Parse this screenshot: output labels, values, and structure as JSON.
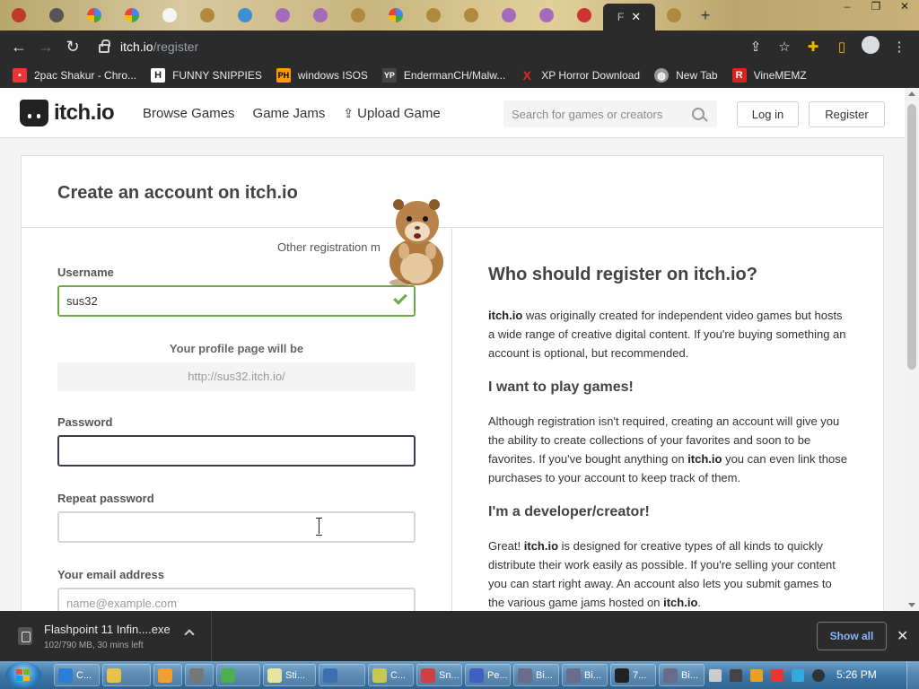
{
  "browser": {
    "active_tab_letter": "F",
    "tab_close": "✕",
    "new_tab": "+",
    "window_controls": [
      "–",
      "❐",
      "✕"
    ],
    "url_host": "itch.io",
    "url_path": "/register",
    "bookmarks": [
      {
        "label": "2pac Shakur - Chro...",
        "icon": "bookmark-icon",
        "color": "#e33"
      },
      {
        "label": "FUNNY SNIPPIES",
        "icon": "H",
        "color": "#333"
      },
      {
        "label": "windows ISOS",
        "icon": "PH",
        "color": "#f90"
      },
      {
        "label": "EndermanCH/Malw...",
        "icon": "YP",
        "color": "#444"
      },
      {
        "label": "XP Horror Download",
        "icon": "X",
        "color": "#e22"
      },
      {
        "label": "New Tab",
        "icon": "globe-icon",
        "color": "#888"
      },
      {
        "label": "VineMEMZ",
        "icon": "R",
        "color": "#d22"
      }
    ]
  },
  "site": {
    "logo": "itch.io",
    "nav": {
      "browse": "Browse Games",
      "jams": "Game Jams",
      "upload": "Upload Game"
    },
    "search_placeholder": "Search for games or creators",
    "login": "Log in",
    "register": "Register"
  },
  "form": {
    "title": "Create an account on itch.io",
    "other_registration": "Other registration m",
    "username_label": "Username",
    "username_value": "sus32",
    "profile_note": "Your profile page will be",
    "profile_url": "http://sus32.itch.io/",
    "password_label": "Password",
    "repeat_password_label": "Repeat password",
    "email_label": "Your email address",
    "email_placeholder": "name@example.com"
  },
  "info": {
    "title": "Who should register on itch.io?",
    "p1_brand": "itch.io",
    "p1_text": " was originally created for independent video games but hosts a wide range of creative digital content. If you're buying something an account is optional, but recommended.",
    "h_play": "I want to play games!",
    "p2_a": "Although registration isn't required, creating an account will give you the ability to create collections of your favorites and soon to be favorites. If you've bought anything on ",
    "p2_brand": "itch.io",
    "p2_b": " you can even link those purchases to your account to keep track of them.",
    "h_dev": "I'm a developer/creator!",
    "p3_a": "Great! ",
    "p3_brand": "itch.io",
    "p3_b": " is designed for creative types of all kinds to quickly distribute their work easily as possible. If you're selling your content you can start right away. An account also lets you submit games to the various game jams hosted on ",
    "p3_brand2": "itch.io",
    "p3_c": "."
  },
  "downloads": {
    "file_name": "Flashpoint 11 Infin....exe",
    "status": "102/790 MB, 30 mins left",
    "show_all": "Show all",
    "close": "✕"
  },
  "taskbar": {
    "tasks": [
      {
        "label": "C...",
        "color": "#2a7fd4"
      },
      {
        "label": "",
        "color": "#e8c14a"
      },
      {
        "label": "",
        "color": "#f0a030"
      },
      {
        "label": "",
        "color": "#777"
      },
      {
        "label": "",
        "color": "#4caf50"
      },
      {
        "label": "Sti...",
        "color": "#e5e5a0"
      },
      {
        "label": "",
        "color": "#3b6fb0"
      },
      {
        "label": "C...",
        "color": "#c8c850"
      },
      {
        "label": "Sn...",
        "color": "#d04040"
      },
      {
        "label": "Pe...",
        "color": "#4060c0"
      },
      {
        "label": "Bi...",
        "color": "#6a6a8a"
      },
      {
        "label": "Bi...",
        "color": "#6a6a8a"
      },
      {
        "label": "7...",
        "color": "#222"
      },
      {
        "label": "Bi...",
        "color": "#6a6a8a"
      }
    ],
    "clock": "5:26 PM"
  },
  "colors": {
    "accent_valid": "#6aaa42",
    "accent_focus": "#3d3a4e",
    "show_all_text": "#8ab4f8"
  }
}
